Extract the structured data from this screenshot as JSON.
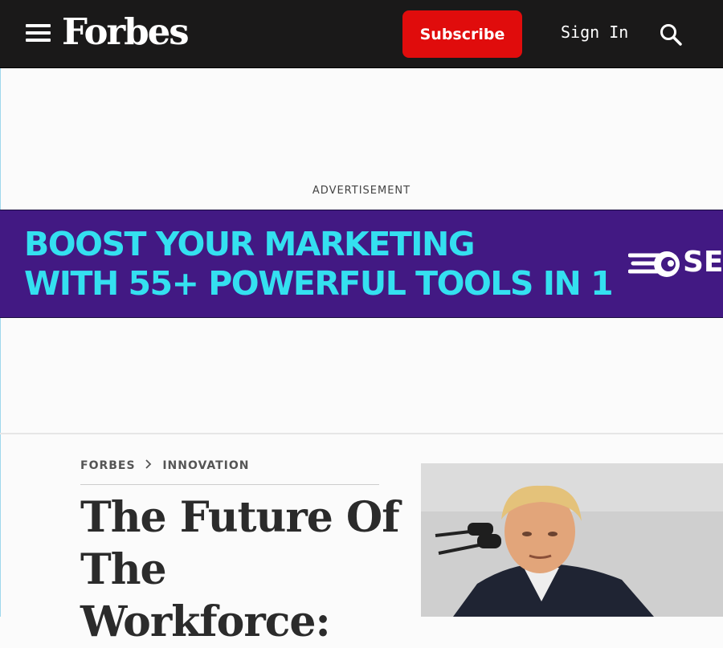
{
  "header": {
    "logo": "Forbes",
    "subscribe_label": "Subscribe",
    "signin_label": "Sign In"
  },
  "ad": {
    "label": "ADVERTISEMENT",
    "line1": "BOOST YOUR MARKETING",
    "line2": "WITH 55+ POWERFUL TOOLS IN 1",
    "brand_partial": "SE"
  },
  "breadcrumb": {
    "items": [
      "FORBES",
      "INNOVATION"
    ]
  },
  "article": {
    "headline": "The Future Of The Workforce:"
  },
  "icons": [
    "menu-icon",
    "search-icon",
    "chevron-right-icon"
  ],
  "colors": {
    "header_bg": "#1a1919",
    "subscribe_bg": "#e00c0c",
    "ad_bg": "#421983",
    "ad_text": "#34e0f0"
  }
}
